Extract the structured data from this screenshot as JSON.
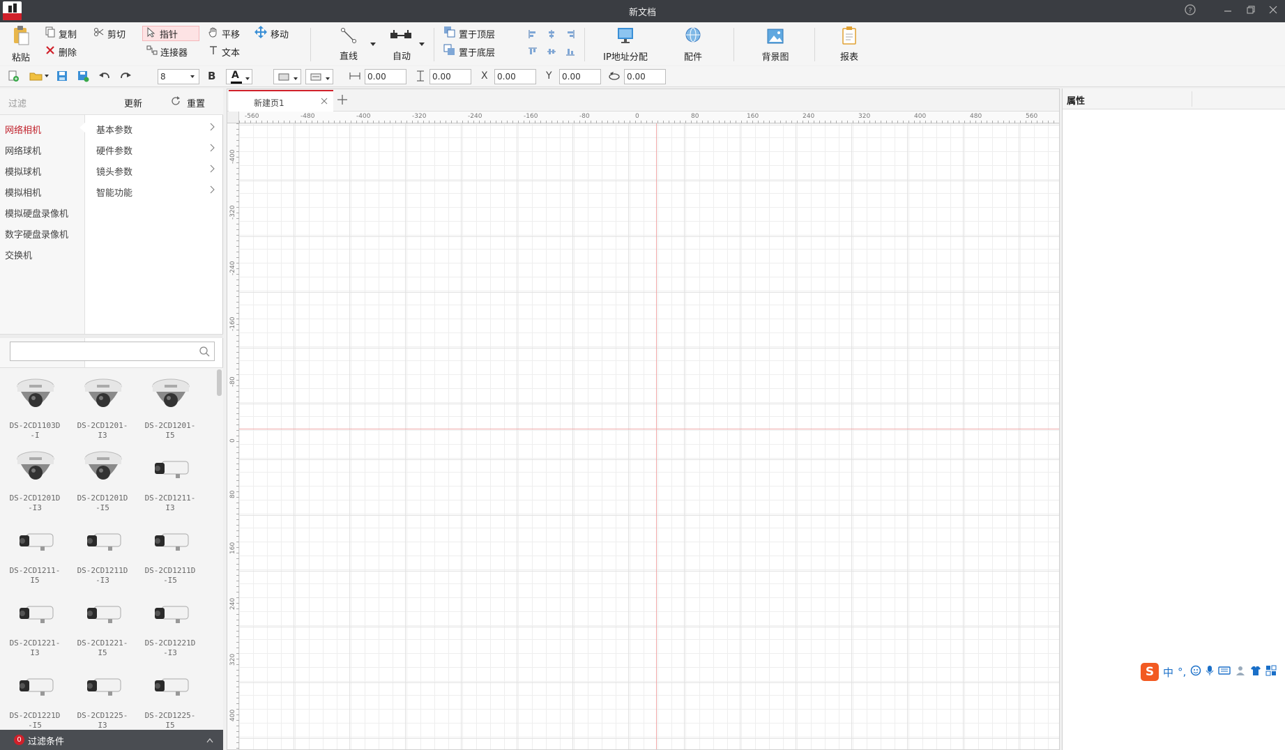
{
  "window": {
    "title": "新文档"
  },
  "ribbon": {
    "paste": "粘贴",
    "copy": "复制",
    "cut": "剪切",
    "delete": "删除",
    "pointer": "指针",
    "connector": "连接器",
    "pan": "平移",
    "text": "文本",
    "move": "移动",
    "line": "直线",
    "auto": "自动",
    "bring_front": "置于顶层",
    "send_back": "置于底层",
    "ip_assign": "IP地址分配",
    "accessories": "配件",
    "background": "背景图",
    "report": "报表"
  },
  "toolbar": {
    "font_size": "8",
    "bold": "B",
    "font_color": "A",
    "width_value": "0.00",
    "height_value": "0.00",
    "x_label": "X",
    "x_value": "0.00",
    "y_label": "Y",
    "y_value": "0.00",
    "rotate_value": "0.00"
  },
  "left": {
    "filter_placeholder": "过滤",
    "update": "更新",
    "reset": "重置",
    "categories": [
      "网络相机",
      "网络球机",
      "模拟球机",
      "模拟相机",
      "模拟硬盘录像机",
      "数字硬盘录像机",
      "交换机"
    ],
    "params": [
      "基本参数",
      "硬件参数",
      "镜头参数",
      "智能功能"
    ],
    "search_placeholder": "",
    "devices": [
      {
        "l1": "DS-2CD1103D",
        "l2": "-I"
      },
      {
        "l1": "DS-2CD1201-",
        "l2": "I3"
      },
      {
        "l1": "DS-2CD1201-",
        "l2": "I5"
      },
      {
        "l1": "DS-2CD1201D",
        "l2": "-I3"
      },
      {
        "l1": "DS-2CD1201D",
        "l2": "-I5"
      },
      {
        "l1": "DS-2CD1211-",
        "l2": "I3"
      },
      {
        "l1": "DS-2CD1211-",
        "l2": "I5"
      },
      {
        "l1": "DS-2CD1211D",
        "l2": "-I3"
      },
      {
        "l1": "DS-2CD1211D",
        "l2": "-I5"
      },
      {
        "l1": "DS-2CD1221-",
        "l2": "I3"
      },
      {
        "l1": "DS-2CD1221-",
        "l2": "I5"
      },
      {
        "l1": "DS-2CD1221D",
        "l2": "-I3"
      },
      {
        "l1": "DS-2CD1221D",
        "l2": "-I5"
      },
      {
        "l1": "DS-2CD1225-",
        "l2": "I3"
      },
      {
        "l1": "DS-2CD1225-",
        "l2": "I5"
      }
    ],
    "bottom_badge": "0",
    "bottom_label": "过滤条件"
  },
  "canvas": {
    "tab_label": "新建页1",
    "hruler": [
      "-560",
      "-480",
      "-400",
      "-320",
      "-240",
      "-160",
      "-80",
      "0",
      "80",
      "160",
      "240",
      "320",
      "400",
      "480",
      "560"
    ],
    "vruler": [
      "-400",
      "-320",
      "-240",
      "-160",
      "-80",
      "0",
      "80",
      "160",
      "240",
      "320",
      "400"
    ]
  },
  "right": {
    "properties_title": "属性"
  },
  "ime": {
    "zh": "中",
    "punct": "°,"
  },
  "colors": {
    "accent_red": "#d0202a",
    "titlebar": "#3a3d42",
    "ime_blue": "#1a6fc8"
  }
}
